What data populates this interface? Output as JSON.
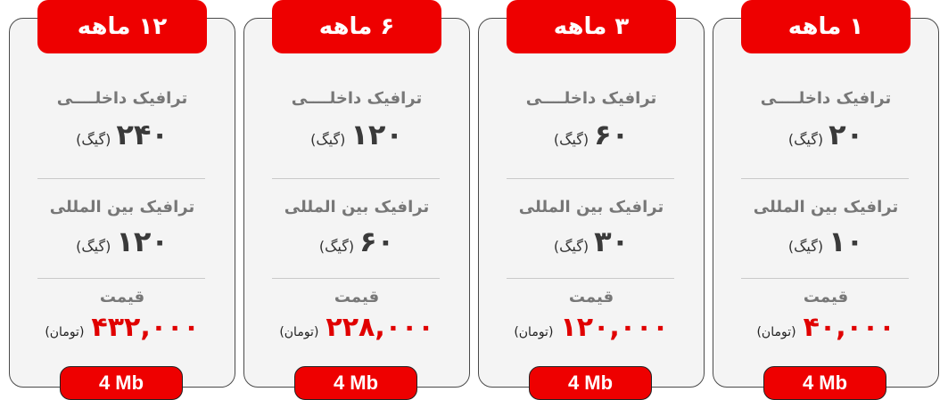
{
  "plans": [
    {
      "period": "۱۲ ماهه",
      "domestic_label": "ترافیک داخلــــی",
      "domestic_value": "۲۴۰",
      "unit": "(گیگ)",
      "international_label": "ترافیک بین المللی",
      "international_value": "۱۲۰",
      "price_label": "قیمت",
      "price": "۴۳۲,۰۰۰",
      "currency": "(تومان)",
      "speed": "4 Mb"
    },
    {
      "period": "۶ ماهه",
      "domestic_label": "ترافیک داخلــــی",
      "domestic_value": "۱۲۰",
      "unit": "(گیگ)",
      "international_label": "ترافیک بین المللی",
      "international_value": "۶۰",
      "price_label": "قیمت",
      "price": "۲۲۸,۰۰۰",
      "currency": "(تومان)",
      "speed": "4 Mb"
    },
    {
      "period": "۳ ماهه",
      "domestic_label": "ترافیک داخلــــی",
      "domestic_value": "۶۰",
      "unit": "(گیگ)",
      "international_label": "ترافیک بین المللی",
      "international_value": "۳۰",
      "price_label": "قیمت",
      "price": "۱۲۰,۰۰۰",
      "currency": "(تومان)",
      "speed": "4 Mb"
    },
    {
      "period": "۱ ماهه",
      "domestic_label": "ترافیک داخلــــی",
      "domestic_value": "۲۰",
      "unit": "(گیگ)",
      "international_label": "ترافیک بین المللی",
      "international_value": "۱۰",
      "price_label": "قیمت",
      "price": "۴۰,۰۰۰",
      "currency": "(تومان)",
      "speed": "4 Mb"
    }
  ],
  "colors": {
    "accent": "#ee0000",
    "card_bg": "#f4f4f4",
    "price": "#e00000"
  }
}
